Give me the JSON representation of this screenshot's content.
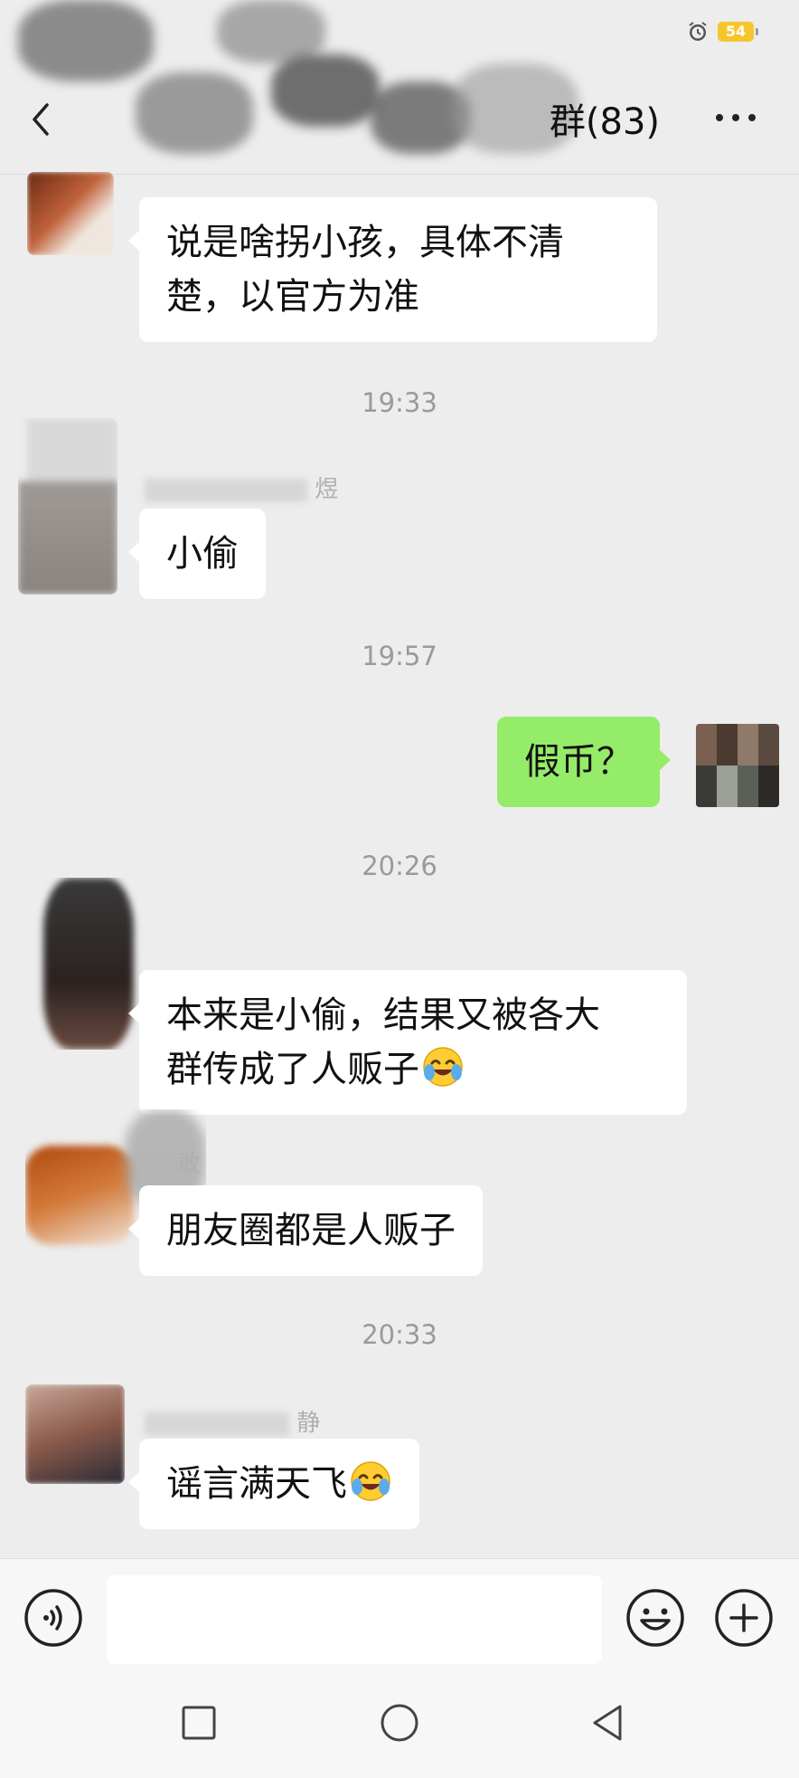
{
  "status_bar": {
    "battery_level": "54",
    "battery_color": "#f6c52a",
    "icons": [
      "alarm-clock-icon",
      "battery-icon"
    ]
  },
  "header": {
    "title": "群(83)",
    "back_icon": "chevron-left-icon",
    "more_icon": "more-dots-icon"
  },
  "messages": [
    {
      "side": "left",
      "text_lines": [
        "说是啥拐小孩，具体不清",
        "楚，以官方为准"
      ]
    },
    {
      "type": "time",
      "text": "19:33"
    },
    {
      "side": "left",
      "sender": "煜",
      "text_lines": [
        "小偷"
      ]
    },
    {
      "type": "time",
      "text": "19:57"
    },
    {
      "side": "right",
      "text_lines": [
        "假币？"
      ]
    },
    {
      "type": "time",
      "text": "20:26"
    },
    {
      "side": "left",
      "text_lines": [
        "本来是小偷，结果又被各大",
        "群传成了人贩子"
      ],
      "emoji": "face-with-tears-of-joy-icon"
    },
    {
      "side": "left",
      "sender": "敢",
      "text_lines": [
        "朋友圈都是人贩子"
      ]
    },
    {
      "type": "time",
      "text": "20:33"
    },
    {
      "side": "left",
      "sender": "静",
      "text_lines": [
        "谣言满天飞"
      ],
      "emoji": "face-with-tears-of-joy-icon"
    }
  ],
  "input_bar": {
    "placeholder": "",
    "value": "",
    "icons": [
      "voice-icon",
      "emoji-icon",
      "plus-icon"
    ]
  },
  "nav_bar": {
    "icons": [
      "recent-apps-icon",
      "home-icon",
      "back-triangle-icon"
    ]
  },
  "colors": {
    "background": "#ededed",
    "bubble_self": "#95ec69",
    "bubble_other": "#ffffff"
  }
}
